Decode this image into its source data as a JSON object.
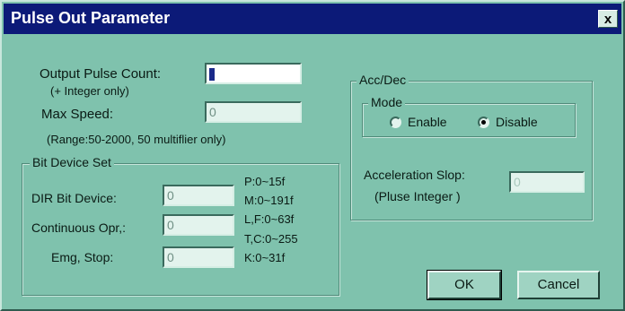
{
  "title": "Pulse Out Parameter",
  "close_label": "x",
  "pulse": {
    "output_pulse_count_label": "Output Pulse Count:",
    "output_pulse_count_hint": "(+ Integer only)",
    "output_pulse_count_value": "",
    "max_speed_label": "Max Speed:",
    "max_speed_value": "0",
    "range_note": "(Range:50-2000, 50 multiflier only)"
  },
  "bit_device_set": {
    "legend": "Bit Device Set",
    "dir_label": "DIR Bit Device:",
    "dir_value": "0",
    "continuous_label": "Continuous Opr,:",
    "continuous_value": "0",
    "emg_label": "Emg, Stop:",
    "emg_value": "0",
    "ranges": [
      "P:0~15f",
      "M:0~191f",
      "L,F:0~63f",
      "T,C:0~255",
      "K:0~31f"
    ]
  },
  "acc_dec": {
    "legend": "Acc/Dec",
    "mode_legend": "Mode",
    "enable_label": "Enable",
    "disable_label": "Disable",
    "selected": "Disable",
    "acceleration_label": "Acceleration Slop:",
    "acceleration_hint": "(Pluse Integer )",
    "acceleration_value": "0"
  },
  "buttons": {
    "ok": "OK",
    "cancel": "Cancel"
  }
}
